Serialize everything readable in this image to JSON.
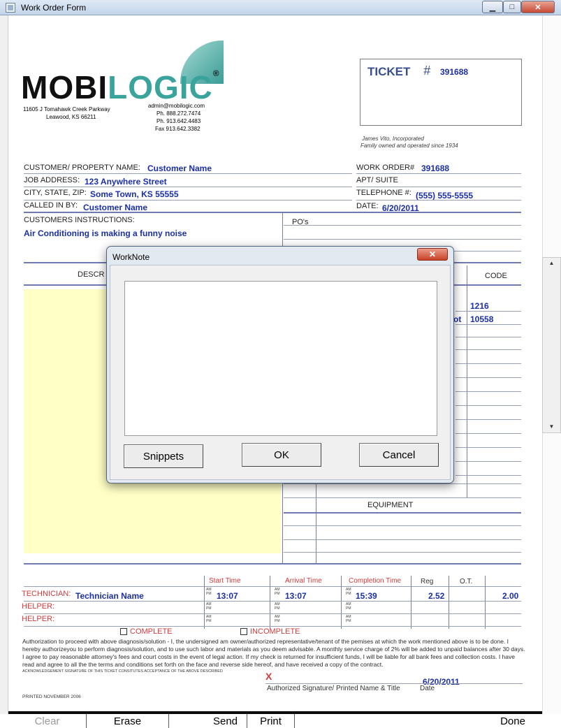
{
  "window": {
    "title": "Work Order Form",
    "minimize_glyph": "▁",
    "maximize_glyph": "□",
    "close_glyph": "✕"
  },
  "company": {
    "logo_part1": "MOBI",
    "logo_part2": "LOGIC",
    "registered": "®",
    "address1": "11605 J Tomahawk Creek Parkway",
    "address2": "Leawood, KS 66211",
    "email": "admin@mobilogic.com",
    "phone1": "Ph. 888.272.7474",
    "phone2": "Ph. 913.642.4483",
    "fax": "Fax 913.642.3382",
    "tag1": "James Vito, Incorporated",
    "tag2": "Family owned and operated since 1934"
  },
  "ticket": {
    "label": "TICKET",
    "hash": "#",
    "number": "391688"
  },
  "form": {
    "customer_label": "CUSTOMER/ PROPERTY NAME:",
    "customer_value": "Customer Name",
    "job_label": "JOB ADDRESS:",
    "job_value": "123 Anywhere Street",
    "city_label": "CITY, STATE, ZIP:",
    "city_value": "Some Town, KS 55555",
    "calledin_label": "CALLED IN BY:",
    "calledin_value": "Customer Name",
    "workorder_label": "WORK ORDER#",
    "workorder_value": "391688",
    "apt_label": "APT/ SUITE",
    "tel_label": "TELEPHONE #:",
    "tel_value": "(555) 555-5555",
    "date_label": "DATE:",
    "date_value": "6/20/2011",
    "instructions_label": "CUSTOMERS INSTRUCTIONS:",
    "instructions_value": "Air Conditioning is making a funny noise",
    "po_label": "PO's",
    "descr_label": "DESCR",
    "code_label": "CODE",
    "code1": "1216",
    "code2_prefix": "ot",
    "code2": "10558",
    "equipment_label": "EQUIPMENT"
  },
  "time_table": {
    "headers": {
      "start": "Start Time",
      "arrival": "Arrival Time",
      "completion": "Completion Time",
      "reg": "Reg",
      "ot": "O.T."
    },
    "am": "AM",
    "pm": "PM",
    "technician_label": "TECHNICIAN:",
    "technician_value": "Technician Name",
    "helper1_label": "HELPER:",
    "helper2_label": "HELPER:",
    "start": "13:07",
    "arrival": "13:07",
    "completion": "15:39",
    "reg": "2.52",
    "ot": "2.00"
  },
  "status": {
    "complete": "COMPLETE",
    "incomplete": "INCOMPLETE"
  },
  "legal": {
    "text": "Authorization to proceed with above diagnosis/solution - I, the undersigned am owner/authorized representative/tenant of the pemises at which the work mentioned above is to be done. I hereby authorizeyou to perform diagnosis/solution, and to use such labor and materials as you deem advisable. A monthly service charge of 2% will be added to unpaid balances after 30 days. I agree to pay reasonable attorney's fees and court costs in the event of legal action. If my check is returned for insufficient funds, I will be liable for all bank fees and collection costs. I have read and agree to all the the terms and conditions set forth on the face and reverse side hereof, and have received a copy of the contract.",
    "ack": "ACKNOWLEDGEMENT SIGNATURE OF THIS TICKET CONSITUTES ACCEPTANCE OF THE ABOVE DESCRIBED",
    "x_mark": "X",
    "sig_date": "6/20/2011",
    "sig_label": "Authorized Signature/ Printed Name & Title",
    "date_label": "Date",
    "printed": "PRINTED NOVEMBER 2006"
  },
  "dialog": {
    "title": "WorkNote",
    "close_glyph": "✕",
    "note_value": "",
    "snippets_label": "Snippets",
    "ok_label": "OK",
    "cancel_label": "Cancel"
  },
  "bottombar": {
    "clear_label": "Clear",
    "erase_label": "Erase",
    "send_label": "Send",
    "print_label": "Print",
    "done_label": "Done"
  },
  "colors": {
    "accent_blue": "#1a2fa8",
    "teal": "#3aa39b",
    "red": "#d23b3b",
    "note_yellow": "#ffffc6"
  }
}
